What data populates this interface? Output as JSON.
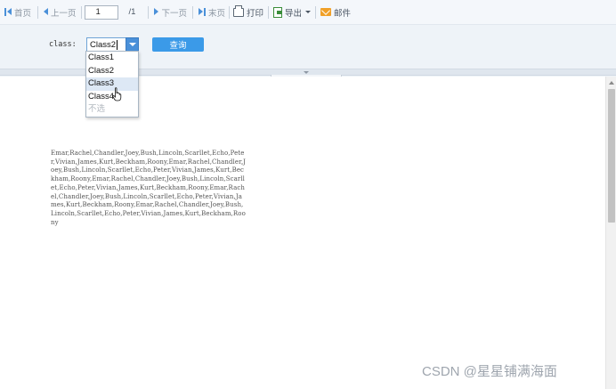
{
  "toolbar": {
    "first_label": "首页",
    "prev_label": "上一页",
    "page_current": "1",
    "page_total": "/1",
    "next_label": "下一页",
    "last_label": "末页",
    "print_label": "打印",
    "export_label": "导出",
    "mail_label": "邮件"
  },
  "params": {
    "class_label": "class:",
    "class_value": "Class2",
    "query_label": "查询",
    "options": [
      {
        "label": "Class1",
        "state": "normal"
      },
      {
        "label": "Class2",
        "state": "normal"
      },
      {
        "label": "Class3",
        "state": "hovered"
      },
      {
        "label": "Class4",
        "state": "normal"
      },
      {
        "label": "不选",
        "state": "disabled"
      }
    ]
  },
  "report": {
    "content": "Emar,Rachel,Chandler,Joey,Bush,Lincoln,Scarllet,Echo,Peter,Vivian,James,Kurt,Beckham,Roony,Emar,Rachel,Chandler,Joey,Bush,Lincoln,Scarllet,Echo,Peter,Vivian,James,Kurt,Beckham,Roony,Emar,Rachel,Chandler,Joey,Bush,Lincoln,Scarllet,Echo,Peter,Vivian,James,Kurt,Beckham,Roony,Emar,Rachel,Chandler,Joey,Bush,Lincoln,Scarllet,Echo,Peter,Vivian,James,Kurt,Beckham,Roony,Emar,Rachel,Chandler,Joey,Bush,Lincoln,Scarllet,Echo,Peter,Vivian,James,Kurt,Beckham,Roony"
  },
  "watermark": "CSDN @星星铺满海面",
  "colors": {
    "accent": "#4a90d9",
    "query_button": "#3b9ae8",
    "hover_item": "#dde8f5",
    "toolbar_bg": "#f4f7fb"
  }
}
